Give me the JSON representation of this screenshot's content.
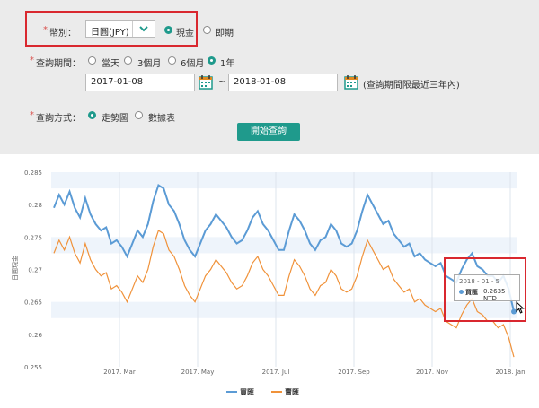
{
  "form": {
    "currency_label": "幣別：",
    "currency_value": "日圓(JPY)",
    "type_options": [
      "現金",
      "即期"
    ],
    "period_label": "查詢期間：",
    "period_options": [
      "當天",
      "3個月",
      "6個月",
      "1年"
    ],
    "start_date": "2017-01-08",
    "tilde": "~",
    "end_date": "2018-01-08",
    "period_note": "(查詢期間限最近三年內)",
    "method_label": "查詢方式：",
    "method_options": [
      "走勢圖",
      "數據表"
    ],
    "submit_label": "開始查詢",
    "required_mark": "*"
  },
  "colors": {
    "accent": "#1f9a8c",
    "buy": "#5b9bd5",
    "sell": "#f0923a",
    "highlight": "#d9282f"
  },
  "icons": {
    "select": "chevron-down-icon",
    "date": "calendar-icon",
    "cursor": "mouse-pointer-icon"
  },
  "tooltip": {
    "date": "2018 - 01 - 5",
    "series": "買匯",
    "value": "0.2635 NTD"
  },
  "chart_data": {
    "type": "line",
    "ylabel": "日圓現金",
    "ylim": [
      0.255,
      0.285
    ],
    "yticks": [
      "0.285",
      "0.28",
      "0.275",
      "0.27",
      "0.265",
      "0.26",
      "0.255"
    ],
    "xticks": [
      "2017. Mar",
      "2017. May",
      "2017. Jul",
      "2017. Sep",
      "2017. Nov",
      "2018. Jan"
    ],
    "grid": true,
    "legend_position": "bottom-center",
    "series": [
      {
        "name": "買匯",
        "color": "#5b9bd5",
        "values": [
          0.2795,
          0.2815,
          0.28,
          0.282,
          0.2795,
          0.278,
          0.281,
          0.2785,
          0.277,
          0.276,
          0.2765,
          0.274,
          0.2745,
          0.2735,
          0.272,
          0.274,
          0.276,
          0.275,
          0.277,
          0.2805,
          0.283,
          0.2825,
          0.28,
          0.279,
          0.277,
          0.2745,
          0.273,
          0.272,
          0.274,
          0.276,
          0.277,
          0.2785,
          0.2775,
          0.2765,
          0.275,
          0.274,
          0.2745,
          0.276,
          0.278,
          0.279,
          0.277,
          0.276,
          0.2745,
          0.273,
          0.273,
          0.276,
          0.2785,
          0.2775,
          0.276,
          0.274,
          0.273,
          0.2745,
          0.275,
          0.277,
          0.276,
          0.274,
          0.2735,
          0.274,
          0.276,
          0.279,
          0.2815,
          0.28,
          0.2785,
          0.277,
          0.2775,
          0.2755,
          0.2745,
          0.2735,
          0.274,
          0.272,
          0.2725,
          0.2715,
          0.271,
          0.2705,
          0.271,
          0.269,
          0.2685,
          0.268,
          0.27,
          0.2715,
          0.2725,
          0.2705,
          0.27,
          0.269,
          0.269,
          0.268,
          0.269,
          0.267,
          0.2635
        ]
      },
      {
        "name": "賣匯",
        "color": "#f0923a",
        "values": [
          0.2725,
          0.2745,
          0.273,
          0.275,
          0.2725,
          0.271,
          0.274,
          0.2715,
          0.27,
          0.269,
          0.2695,
          0.267,
          0.2675,
          0.2665,
          0.265,
          0.267,
          0.269,
          0.268,
          0.27,
          0.2735,
          0.276,
          0.2755,
          0.273,
          0.272,
          0.27,
          0.2675,
          0.266,
          0.265,
          0.267,
          0.269,
          0.27,
          0.2715,
          0.2705,
          0.2695,
          0.268,
          0.267,
          0.2675,
          0.269,
          0.271,
          0.272,
          0.27,
          0.269,
          0.2675,
          0.266,
          0.266,
          0.269,
          0.2715,
          0.2705,
          0.269,
          0.267,
          0.266,
          0.2675,
          0.268,
          0.27,
          0.269,
          0.267,
          0.2665,
          0.267,
          0.269,
          0.272,
          0.2745,
          0.273,
          0.2715,
          0.27,
          0.2705,
          0.2685,
          0.2675,
          0.2665,
          0.267,
          0.265,
          0.2655,
          0.2645,
          0.264,
          0.2635,
          0.264,
          0.262,
          0.2615,
          0.261,
          0.263,
          0.2645,
          0.2655,
          0.2635,
          0.263,
          0.262,
          0.262,
          0.261,
          0.2615,
          0.2595,
          0.2565
        ]
      }
    ]
  }
}
